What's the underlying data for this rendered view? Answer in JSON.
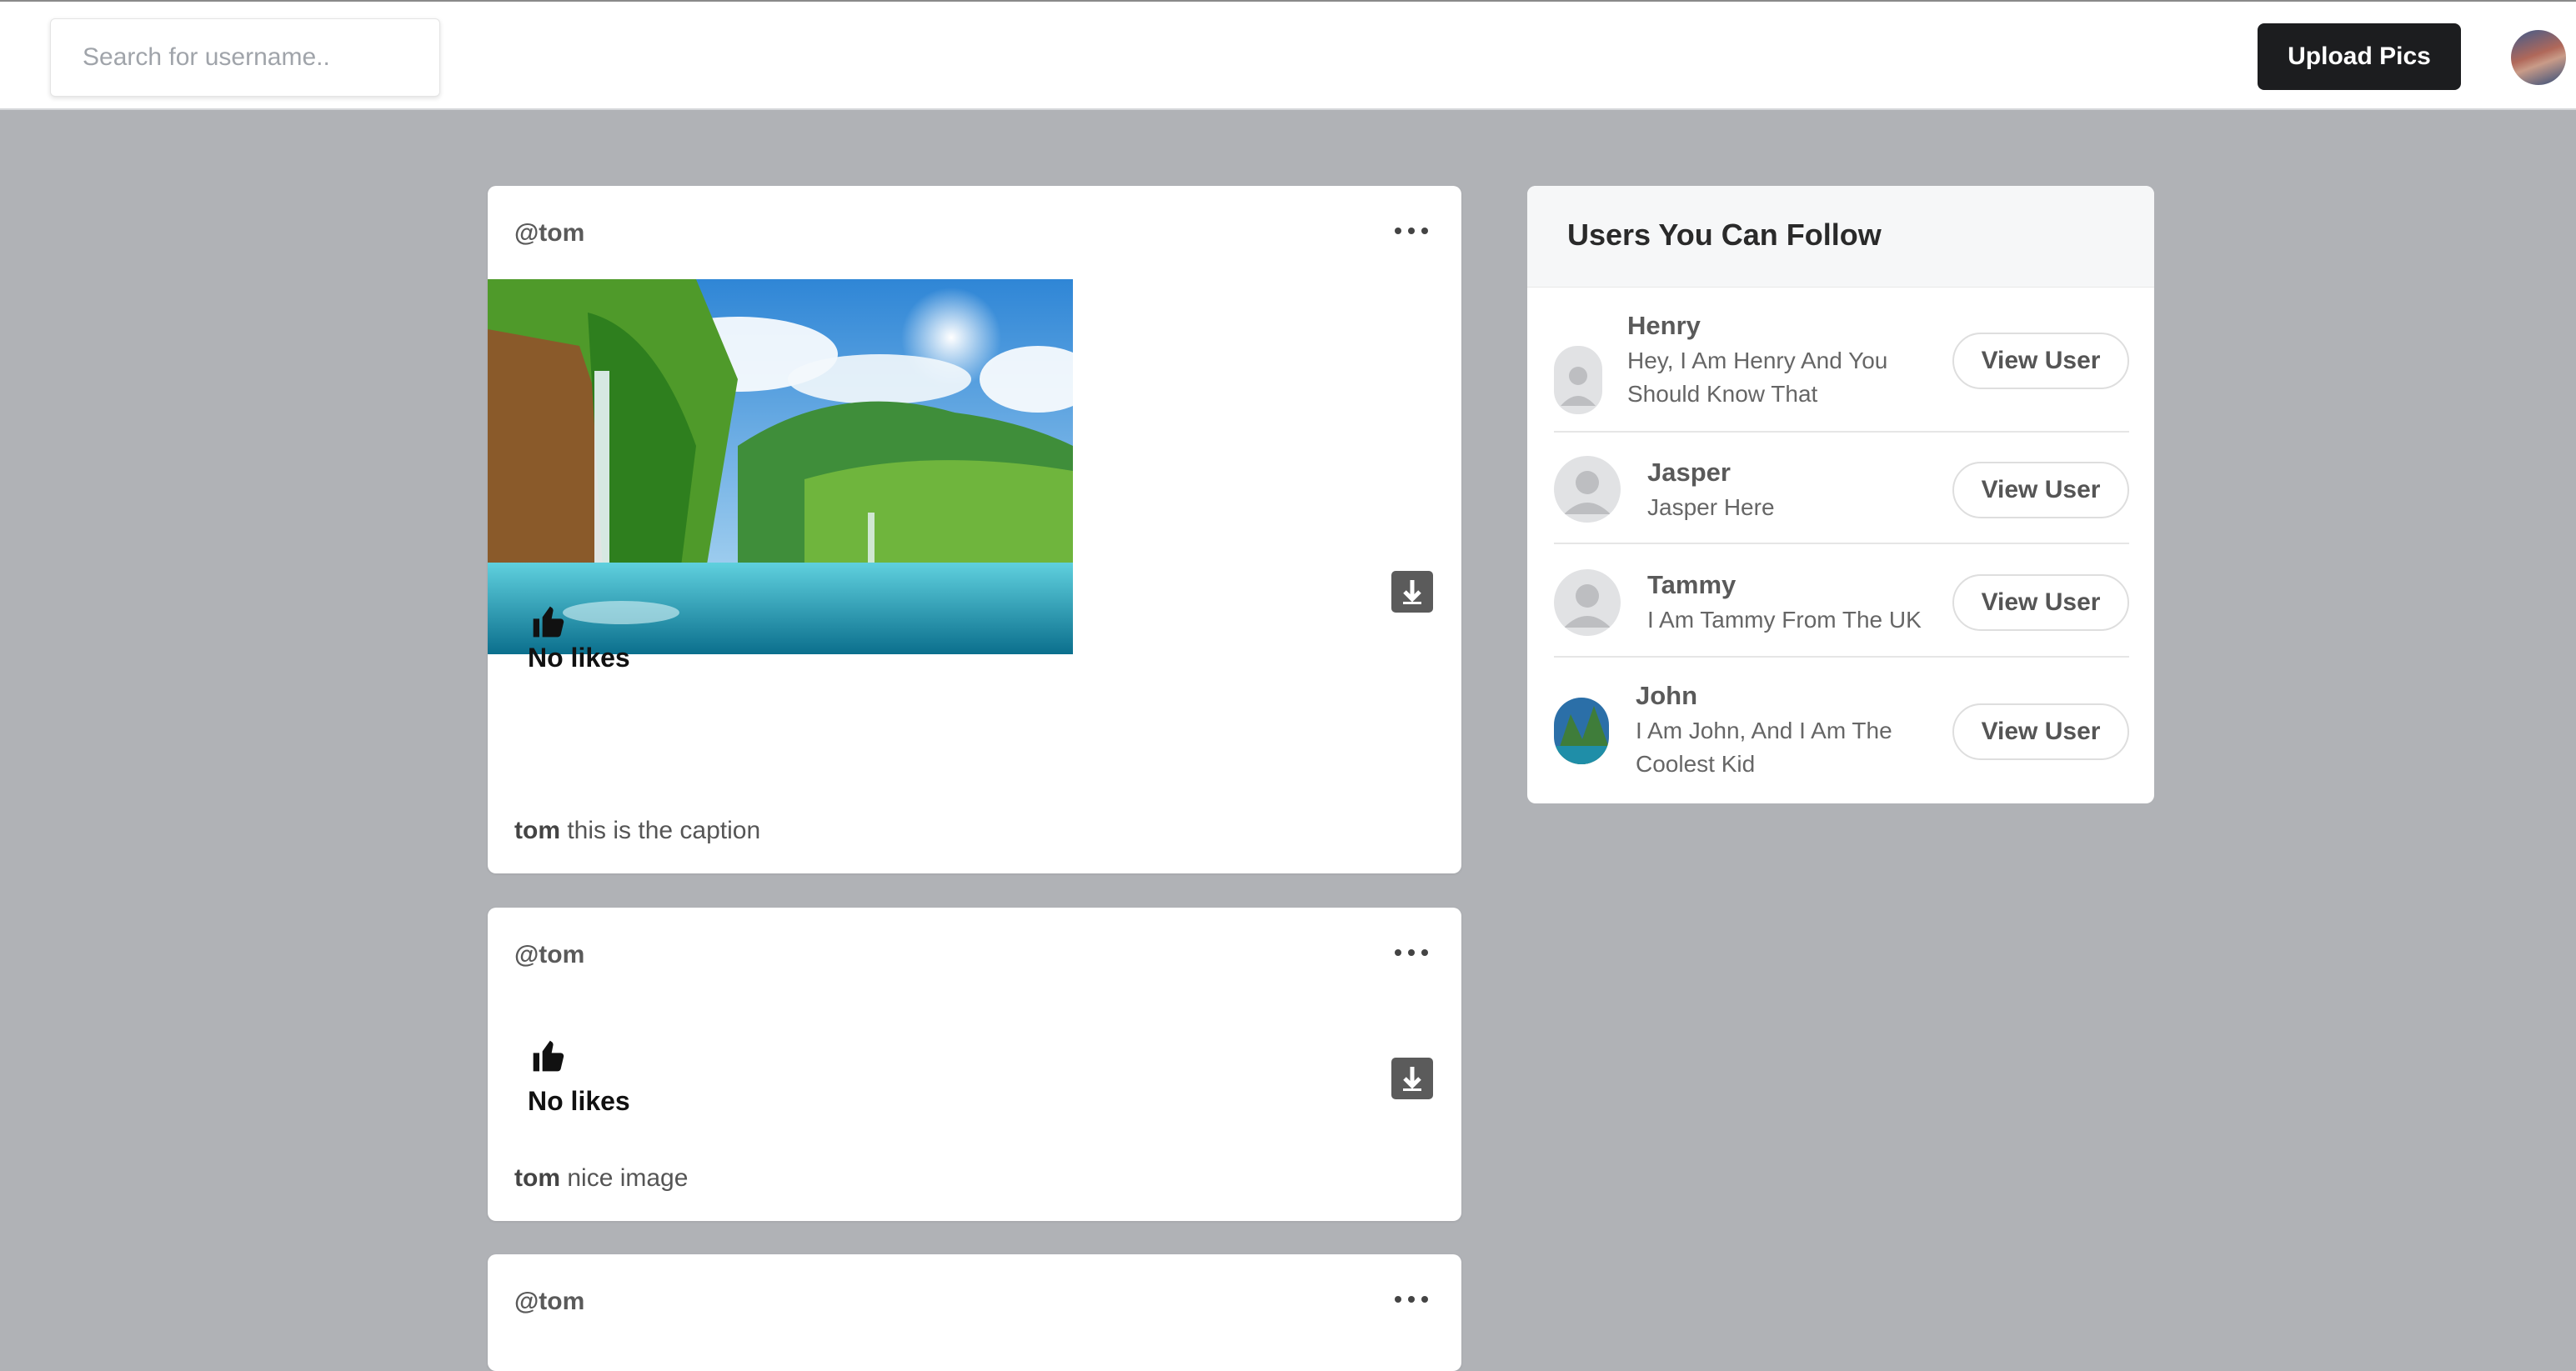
{
  "search": {
    "placeholder": "Search for username.."
  },
  "header": {
    "upload_label": "Upload Pics"
  },
  "posts": [
    {
      "user": "@tom",
      "likes": "No likes",
      "caption_user": "tom",
      "caption": "this is the caption"
    },
    {
      "user": "@tom",
      "likes": "No likes",
      "caption_user": "tom",
      "caption": "nice image"
    },
    {
      "user": "@tom"
    }
  ],
  "suggestions": {
    "title": "Users You Can Follow",
    "button_label": "View User",
    "users": [
      {
        "name": "Henry",
        "bio": "Hey, I Am Henry And You Should Know That"
      },
      {
        "name": "Jasper",
        "bio": "Jasper Here"
      },
      {
        "name": "Tammy",
        "bio": "I Am Tammy From The UK"
      },
      {
        "name": "John",
        "bio": "I Am John, And I Am The Coolest Kid"
      }
    ]
  },
  "colors": {
    "page_bg": "#b0b2b6",
    "button_dark": "#1c1d1f",
    "card_bg": "#ffffff"
  },
  "icons": [
    "thumbs-up-icon",
    "download-icon",
    "more-dots-icon",
    "avatar-placeholder-icon"
  ]
}
